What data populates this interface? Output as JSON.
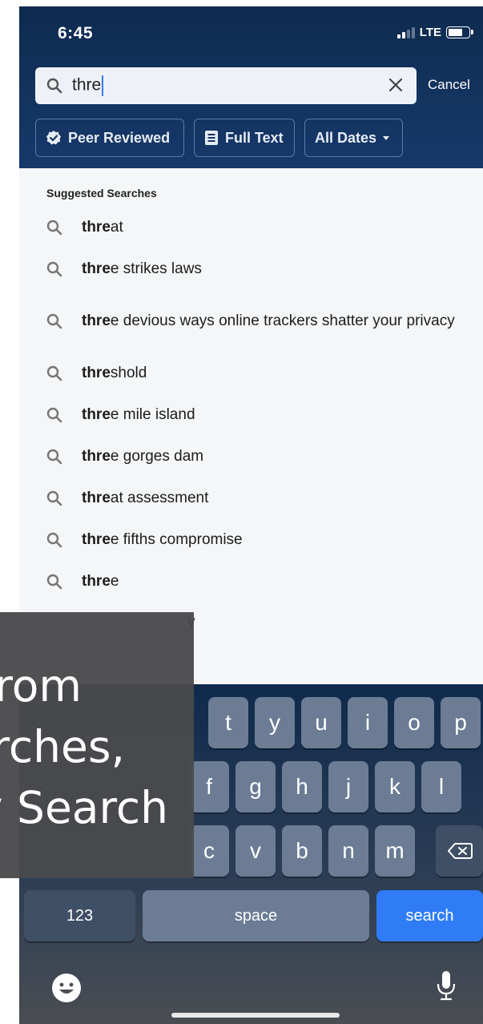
{
  "status_bar": {
    "time": "6:45",
    "network": "LTE"
  },
  "search": {
    "query": "thre",
    "cancel_label": "Cancel"
  },
  "filters": [
    {
      "label": "Peer Reviewed",
      "icon": "badge-check-icon"
    },
    {
      "label": "Full Text",
      "icon": "document-icon"
    },
    {
      "label": "All Dates",
      "icon": "dropdown-arrow-icon"
    }
  ],
  "suggestions": {
    "title": "Suggested Searches",
    "items": [
      {
        "bold": "thre",
        "rest": "at"
      },
      {
        "bold": "thre",
        "rest": "e strikes laws"
      },
      {
        "bold": "thre",
        "rest": "e devious ways online trackers shatter your privacy"
      },
      {
        "bold": "thre",
        "rest": "shold"
      },
      {
        "bold": "thre",
        "rest": "e mile island"
      },
      {
        "bold": "thre",
        "rest": "e gorges dam"
      },
      {
        "bold": "thre",
        "rest": "at assessment"
      },
      {
        "bold": "thre",
        "rest": "e fifths compromise"
      },
      {
        "bold": "thre",
        "rest": "e"
      }
    ],
    "partial_visible_text": "y"
  },
  "overlay": {
    "lines": [
      "rom",
      "rches,",
      "v Search"
    ]
  },
  "keyboard": {
    "row1": [
      "t",
      "y",
      "u",
      "i",
      "o",
      "p"
    ],
    "row2": [
      "f",
      "g",
      "h",
      "j",
      "k",
      "l"
    ],
    "row3": [
      "c",
      "v",
      "b",
      "n",
      "m"
    ],
    "numbers_label": "123",
    "space_label": "space",
    "search_label": "search"
  }
}
